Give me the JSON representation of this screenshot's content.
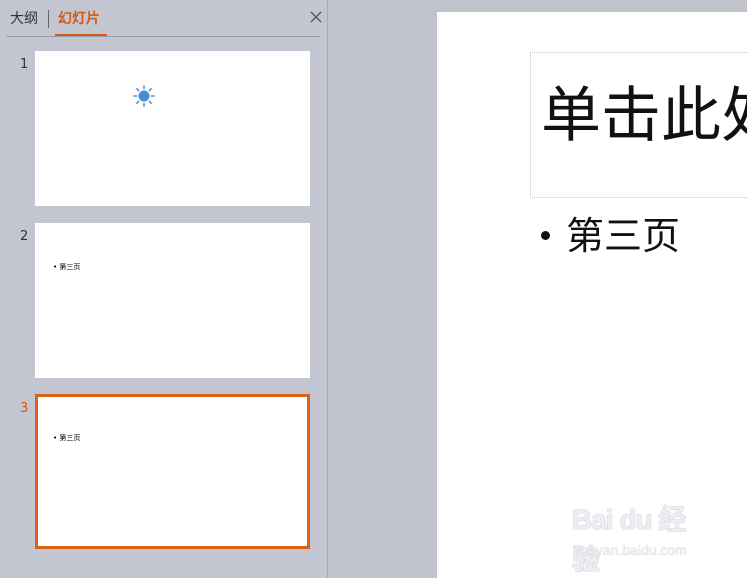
{
  "panel": {
    "tabs": [
      {
        "label": "大纲",
        "active": false
      },
      {
        "label": "幻灯片",
        "active": true
      }
    ],
    "accent_color": "#d35a14"
  },
  "slides": [
    {
      "number": "1",
      "content": "",
      "has_sun_icon": true,
      "selected": false
    },
    {
      "number": "2",
      "content": "• 第三页",
      "selected": false
    },
    {
      "number": "3",
      "content": "• 第三页",
      "selected": true
    }
  ],
  "editor": {
    "title_placeholder": "单击此处",
    "bullet_text": "第三页"
  },
  "watermark": {
    "main": "Bai du 经验",
    "sub": "jingyan.baidu.com"
  }
}
